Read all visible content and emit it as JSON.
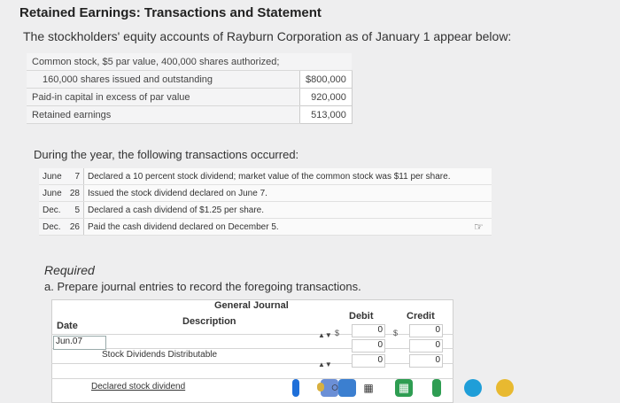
{
  "title": "Retained Earnings: Transactions and Statement",
  "intro": "The stockholders' equity accounts of Rayburn Corporation as of January 1 appear below:",
  "equity_rows": [
    {
      "label": "Common stock, $5 par value, 400,000 shares authorized;",
      "value": ""
    },
    {
      "label": "160,000 shares issued and outstanding",
      "value": "$800,000"
    },
    {
      "label": "Paid-in capital in excess of par value",
      "value": "920,000"
    },
    {
      "label": "Retained earnings",
      "value": "513,000"
    }
  ],
  "during": "During the year, the following transactions occurred:",
  "transactions": [
    {
      "month": "June",
      "day": "7",
      "text": "Declared a 10 percent stock dividend; market value of the common stock was $11 per share."
    },
    {
      "month": "June",
      "day": "28",
      "text": "Issued the stock dividend declared on June 7."
    },
    {
      "month": "Dec.",
      "day": "5",
      "text": "Declared a cash dividend of $1.25 per share."
    },
    {
      "month": "Dec.",
      "day": "26",
      "text": "Paid the cash dividend declared on December 5."
    }
  ],
  "required": "Required",
  "part_a": "a. Prepare journal entries to record the foregoing transactions.",
  "journal": {
    "title": "General Journal",
    "col_date": "Date",
    "col_description": "Description",
    "col_debit": "Debit",
    "col_credit": "Credit",
    "rows": [
      {
        "date": "Jun.07",
        "description": "",
        "debit_sign": "$",
        "debit": "0",
        "credit_sign": "$",
        "credit": "0"
      },
      {
        "date": "",
        "description": "Stock Dividends Distributable",
        "debit_sign": "",
        "debit": "0",
        "credit_sign": "",
        "credit": "0"
      },
      {
        "date": "",
        "description": "",
        "debit_sign": "",
        "debit": "0",
        "credit_sign": "",
        "credit": "0"
      },
      {
        "date": "",
        "description": "Declared stock dividend",
        "debit_sign": "",
        "debit": "",
        "credit_sign": "",
        "credit": ""
      }
    ]
  },
  "colors": {
    "accent_blue": "#1e6fd9",
    "green": "#2e9d52"
  },
  "taskbar_icons": [
    "app-icon",
    "app-icon",
    "store-icon",
    "windows-icon",
    "search-circle-icon",
    "task-view-icon",
    "file-explorer-icon",
    "app-icon",
    "edge-icon",
    "chrome-icon"
  ]
}
